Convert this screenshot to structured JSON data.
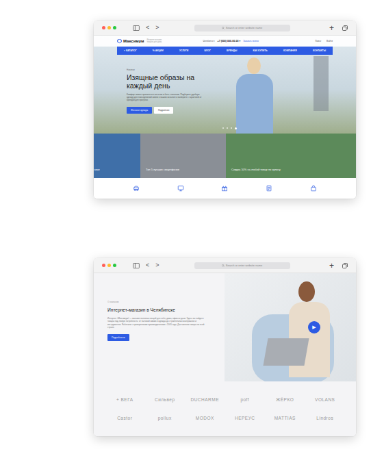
{
  "windows": [
    {
      "lights": [
        {
          "color": "#ff5f57"
        },
        {
          "color": "#febc2e"
        },
        {
          "color": "#28c840"
        }
      ],
      "back": "<",
      "forward": ">",
      "address": "Search or enter website name",
      "new_tab": "+"
    },
    {
      "lights": [
        {
          "color": "#ff5f57"
        },
        {
          "color": "#febc2e"
        },
        {
          "color": "#28c840"
        }
      ],
      "back": "<",
      "forward": ">",
      "address": "Search or enter website name",
      "new_tab": "+"
    }
  ],
  "home": {
    "logo": "Максимум",
    "tagline": "Интернет-магазин товаров для дома",
    "city": "Челябинск ▾",
    "phone": "+7 (000) 000-00-00 ▾",
    "callback": "Заказать звонок",
    "search": "Поиск",
    "login": "Войти",
    "menu": [
      {
        "label": "≡ КАТАЛОГ"
      },
      {
        "label": "% АКЦИИ"
      },
      {
        "label": "УСЛУГИ"
      },
      {
        "label": "БЛОГ"
      },
      {
        "label": "БРЕНДЫ"
      },
      {
        "label": "КАК КУПИТЬ"
      },
      {
        "label": "КОМПАНИЯ"
      },
      {
        "label": "КОНТАКТЫ"
      }
    ],
    "hero": {
      "eyebrow": "Новинки",
      "title": "Изящные образы на каждый день",
      "text": "Комфорт может проявляться во всем и быть стильным. Подберите удобную одежду для повседневной жизни в нашем каталоге и выберите с гарантией от брендов для прогулок.",
      "buttons": [
        {
          "label": "Женская одежда",
          "primary": true
        },
        {
          "label": "Подробнее",
          "primary": false
        }
      ],
      "dots": [
        {
          "selected": false
        },
        {
          "selected": false
        },
        {
          "selected": false
        },
        {
          "selected": true
        }
      ]
    },
    "banners": [
      {
        "caption": "ники",
        "color": "#3f6fa8"
      },
      {
        "caption": "Топ 5 лучших смартфонов",
        "color": "#8a8f96"
      },
      {
        "caption": "Скидка 10% на любой товар по купону",
        "color": "#5c8a5a"
      }
    ]
  },
  "about": {
    "eyebrow": "О компании",
    "title": "Интернет-магазин в Челябинске",
    "text": "Интернет «Максимум» — магазин полезных вещей для себя, дома, офиса и дачи. Здесь вы найдете товары под любую потребность: от бытовой химии и одежды до строительных материалов и инструментов. Работаем с проверенными производителями с 2005 года. Доставляем товары по всей стране.",
    "button": "Подробности",
    "play": "▶",
    "brands": [
      "+ ВЕГА",
      "Сильвер",
      "DUCHARME",
      "poff",
      "ЖЁРКО",
      "VOLANS",
      "Castor",
      "pollux",
      "MODOX",
      "НЕРЕУС",
      "MATTIAS",
      "Lindros"
    ]
  }
}
